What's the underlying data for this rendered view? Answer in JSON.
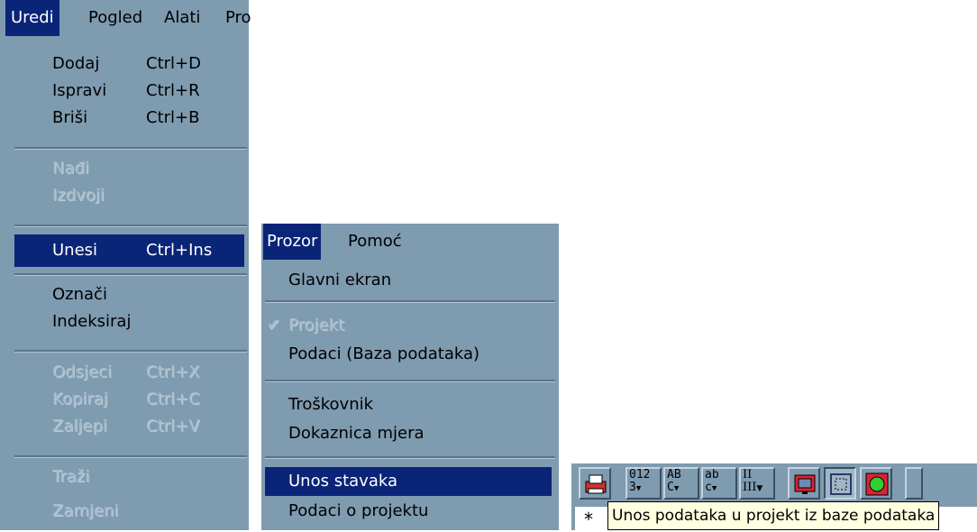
{
  "menu1": {
    "bar": [
      "Uredi",
      "Pogled",
      "Alati",
      "Pro"
    ],
    "items": [
      {
        "label": "Dodaj",
        "shortcut": "Ctrl+D"
      },
      {
        "label": "Ispravi",
        "shortcut": "Ctrl+R"
      },
      {
        "label": "Briši",
        "shortcut": "Ctrl+B"
      },
      {
        "label": "Nađi",
        "shortcut": ""
      },
      {
        "label": "Izdvoji",
        "shortcut": ""
      },
      {
        "label": "Unesi",
        "shortcut": "Ctrl+Ins"
      },
      {
        "label": "Označi",
        "shortcut": ""
      },
      {
        "label": "Indeksiraj",
        "shortcut": ""
      },
      {
        "label": "Odsjeci",
        "shortcut": "Ctrl+X"
      },
      {
        "label": "Kopiraj",
        "shortcut": "Ctrl+C"
      },
      {
        "label": "Zaljepi",
        "shortcut": "Ctrl+V"
      },
      {
        "label": "Traži",
        "shortcut": ""
      },
      {
        "label": "Zamjeni",
        "shortcut": ""
      }
    ]
  },
  "menu2": {
    "bar": [
      "Prozor",
      "Pomoć"
    ],
    "items": [
      {
        "label": "Glavni ekran"
      },
      {
        "label": "Projekt",
        "checkmark": "✔"
      },
      {
        "label": "Podaci (Baza podataka)"
      },
      {
        "label": "Troškovnik"
      },
      {
        "label": "Dokaznica mjera"
      },
      {
        "label": "Unos stavaka"
      },
      {
        "label": "Podaci o projektu"
      }
    ]
  },
  "toolbar": {
    "b1": {
      "line1": "012",
      "line2": "3"
    },
    "b2": {
      "line1": "AB",
      "line2": "C"
    },
    "b3": {
      "line1": "ab",
      "line2": "c"
    },
    "b4": {
      "line1": "II",
      "line2": "III"
    },
    "tooltip": "Unos podataka u projekt iz baze podataka",
    "marker": "*"
  },
  "colors": {
    "menu_bg": "#7e9bb0",
    "highlight": "#0a2478",
    "disabled": "#a8bccb",
    "tooltip_bg": "#ffffe1"
  }
}
